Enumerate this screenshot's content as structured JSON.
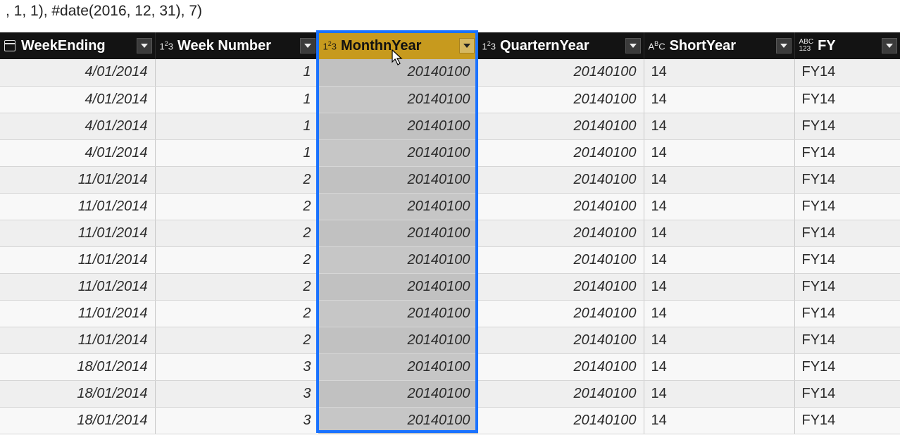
{
  "formula": ", 1, 1), #date(2016, 12, 31), 7)",
  "columns": [
    {
      "label": "WeekEnding",
      "type": "date",
      "align": "num",
      "selected": false
    },
    {
      "label": "Week Number",
      "type": "int",
      "align": "num",
      "selected": false
    },
    {
      "label": "MonthnYear",
      "type": "int",
      "align": "num",
      "selected": true
    },
    {
      "label": "QuarternYear",
      "type": "int",
      "align": "num",
      "selected": false
    },
    {
      "label": "ShortYear",
      "type": "text",
      "align": "txt",
      "selected": false
    },
    {
      "label": "FY",
      "type": "any",
      "align": "txt",
      "selected": false
    }
  ],
  "type_labels": {
    "int": "1²3",
    "text": "AᴮC",
    "any": "ABC 123"
  },
  "rows": [
    [
      "4/01/2014",
      "1",
      "20140100",
      "20140100",
      "14",
      "FY14"
    ],
    [
      "4/01/2014",
      "1",
      "20140100",
      "20140100",
      "14",
      "FY14"
    ],
    [
      "4/01/2014",
      "1",
      "20140100",
      "20140100",
      "14",
      "FY14"
    ],
    [
      "4/01/2014",
      "1",
      "20140100",
      "20140100",
      "14",
      "FY14"
    ],
    [
      "11/01/2014",
      "2",
      "20140100",
      "20140100",
      "14",
      "FY14"
    ],
    [
      "11/01/2014",
      "2",
      "20140100",
      "20140100",
      "14",
      "FY14"
    ],
    [
      "11/01/2014",
      "2",
      "20140100",
      "20140100",
      "14",
      "FY14"
    ],
    [
      "11/01/2014",
      "2",
      "20140100",
      "20140100",
      "14",
      "FY14"
    ],
    [
      "11/01/2014",
      "2",
      "20140100",
      "20140100",
      "14",
      "FY14"
    ],
    [
      "11/01/2014",
      "2",
      "20140100",
      "20140100",
      "14",
      "FY14"
    ],
    [
      "11/01/2014",
      "2",
      "20140100",
      "20140100",
      "14",
      "FY14"
    ],
    [
      "18/01/2014",
      "3",
      "20140100",
      "20140100",
      "14",
      "FY14"
    ],
    [
      "18/01/2014",
      "3",
      "20140100",
      "20140100",
      "14",
      "FY14"
    ],
    [
      "18/01/2014",
      "3",
      "20140100",
      "20140100",
      "14",
      "FY14"
    ]
  ]
}
